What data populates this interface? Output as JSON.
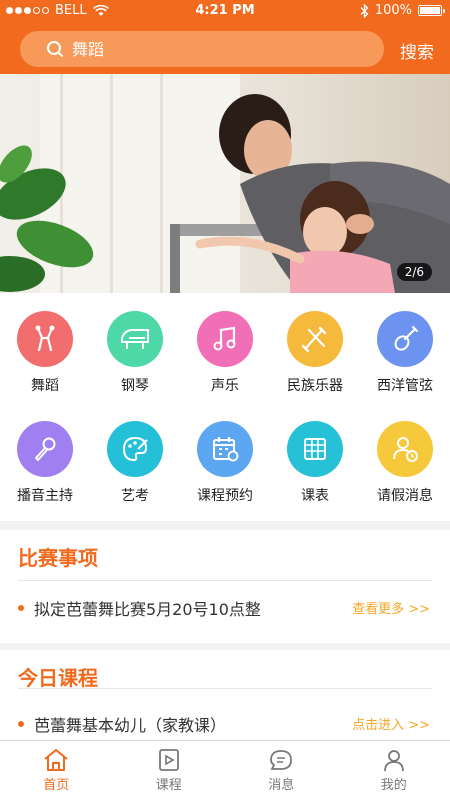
{
  "status_bar": {
    "carrier": "BELL",
    "time": "4:21 PM",
    "battery": "100%"
  },
  "search": {
    "placeholder": "舞蹈",
    "button_label": "搜索"
  },
  "banner": {
    "pager": "2/6"
  },
  "grid": [
    {
      "label": "舞蹈",
      "icon": "dance-icon",
      "color": "#f26e6e"
    },
    {
      "label": "钢琴",
      "icon": "piano-icon",
      "color": "#4ed8a8"
    },
    {
      "label": "声乐",
      "icon": "music-note-icon",
      "color": "#f06fb6"
    },
    {
      "label": "民族乐器",
      "icon": "suona-icon",
      "color": "#f5b93b"
    },
    {
      "label": "西洋管弦",
      "icon": "violin-icon",
      "color": "#6d93f0"
    },
    {
      "label": "播音主持",
      "icon": "microphone-icon",
      "color": "#a07ff0"
    },
    {
      "label": "艺考",
      "icon": "palette-icon",
      "color": "#23c0d8"
    },
    {
      "label": "课程预约",
      "icon": "calendar-icon",
      "color": "#5da7f2"
    },
    {
      "label": "课表",
      "icon": "timetable-icon",
      "color": "#26c1d6"
    },
    {
      "label": "请假消息",
      "icon": "leave-icon",
      "color": "#f5c93b"
    }
  ],
  "competition": {
    "title": "比赛事项",
    "item": "拟定芭蕾舞比赛5月20号10点整",
    "more": "查看更多 >>"
  },
  "today": {
    "title": "今日课程",
    "item": "芭蕾舞基本幼儿（家教课）",
    "more": "点击进入 >>"
  },
  "tabs": [
    {
      "label": "首页",
      "icon": "home-icon",
      "active": true
    },
    {
      "label": "课程",
      "icon": "course-icon",
      "active": false
    },
    {
      "label": "消息",
      "icon": "message-icon",
      "active": false
    },
    {
      "label": "我的",
      "icon": "profile-icon",
      "active": false
    }
  ],
  "colors": {
    "accent": "#f26a1e",
    "more_link": "#f5a623"
  }
}
